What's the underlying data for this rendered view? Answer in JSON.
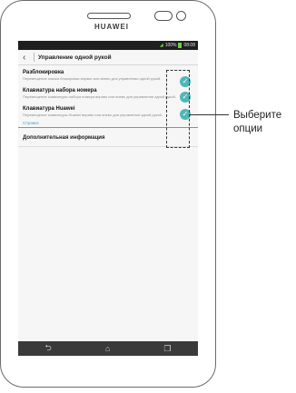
{
  "device": {
    "brand": "HUAWEI"
  },
  "statusbar": {
    "battery": "100%",
    "time": "08:08"
  },
  "header": {
    "title": "Управление одной рукой"
  },
  "items": [
    {
      "title": "Разблокировка",
      "desc": "Перемещение значка блокировки вправо или влево для управления одной рукой."
    },
    {
      "title": "Клавиатура набора номера",
      "desc": "Перемещение клавиатуры набора номера вправо или влево для управления одной рукой."
    },
    {
      "title": "Клавиатура Huawei",
      "desc": "Перемещение клавиатуры Huawei вправо или влево для управления одной рукой."
    }
  ],
  "section": {
    "label": "Справка"
  },
  "more": {
    "label": "Дополнительная информация"
  },
  "navbar": {
    "back_icon": "back-arrow-icon",
    "home_icon": "home-icon",
    "recent_icon": "recent-apps-icon"
  },
  "callout": {
    "line1": "Выберите",
    "line2": "опции"
  },
  "colors": {
    "check": "#4fb8b7",
    "accent": "#4aa6d8"
  }
}
